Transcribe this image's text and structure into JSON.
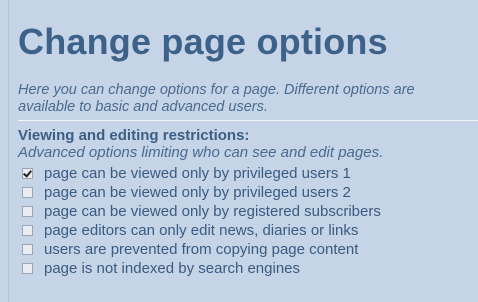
{
  "page": {
    "title": "Change page options",
    "intro_line1": "Here you can change options for a page.  Different options are",
    "intro_line2": "available to basic and advanced users."
  },
  "section": {
    "heading": "Viewing and editing restrictions:",
    "description": "Advanced options limiting who can see and edit pages.",
    "options": [
      {
        "label": "page can be viewed only by privileged users 1",
        "checked": true
      },
      {
        "label": "page can be viewed only by privileged users 2",
        "checked": false
      },
      {
        "label": "page can be viewed only by registered subscribers",
        "checked": false
      },
      {
        "label": "page editors can only edit news, diaries or links",
        "checked": false
      },
      {
        "label": "users are prevented from copying page content",
        "checked": false
      },
      {
        "label": "page is not indexed by search engines",
        "checked": false
      }
    ]
  }
}
